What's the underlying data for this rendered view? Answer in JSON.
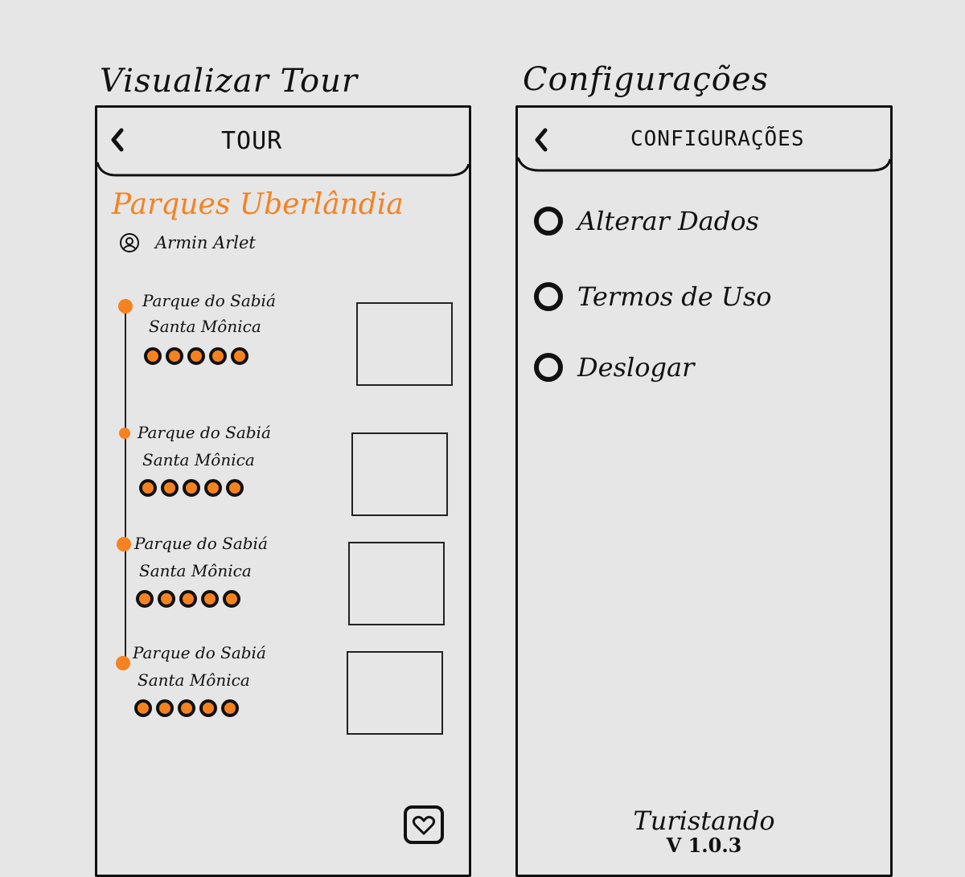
{
  "captions": {
    "left": "Visualizar Tour",
    "right": "Configurações"
  },
  "tour_screen": {
    "header_title": "TOUR",
    "tour_name": "Parques Uberlândia",
    "author": "Armin Arlet",
    "stops": [
      {
        "name": "Parque do Sabiá",
        "neighborhood": "Santa Mônica",
        "rating_dots": 5
      },
      {
        "name": "Parque do Sabiá",
        "neighborhood": "Santa Mônica",
        "rating_dots": 5
      },
      {
        "name": "Parque do Sabiá",
        "neighborhood": "Santa Mônica",
        "rating_dots": 5
      },
      {
        "name": "Parque do Sabiá",
        "neighborhood": "Santa Mônica",
        "rating_dots": 5
      }
    ],
    "accent_color": "#f5821f"
  },
  "settings_screen": {
    "header_title": "CONFIGURAÇÕES",
    "menu": [
      {
        "label": "Alterar Dados"
      },
      {
        "label": "Termos de Uso"
      },
      {
        "label": "Deslogar"
      }
    ],
    "app_name": "Turistando",
    "app_version": "V 1.0.3"
  }
}
